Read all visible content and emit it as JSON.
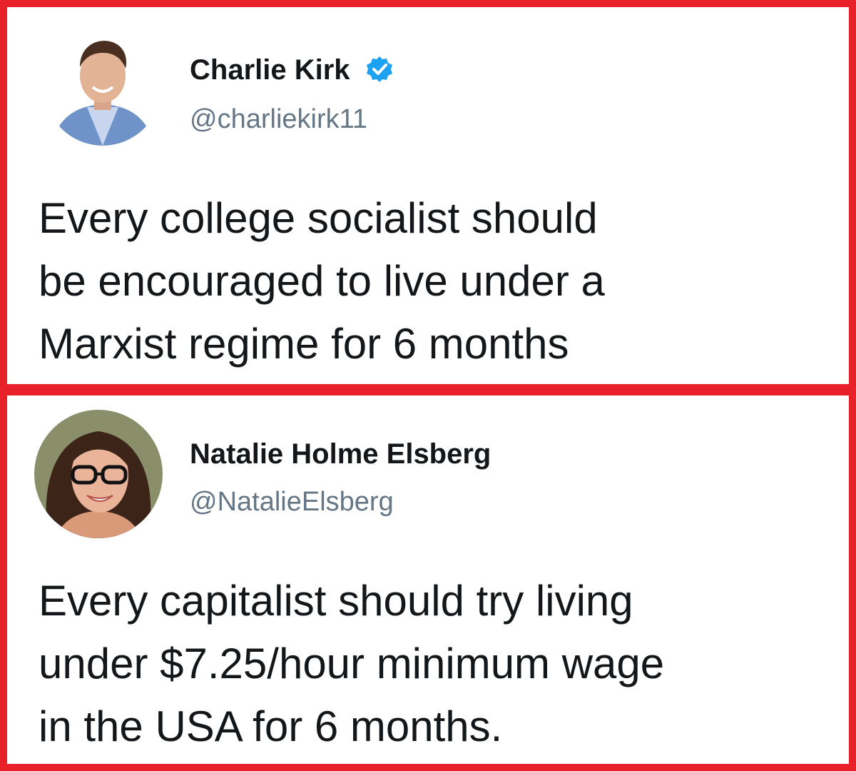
{
  "tweets": [
    {
      "author_name": "Charlie Kirk",
      "author_handle": "@charliekirk11",
      "verified": true,
      "text_lines": [
        "Every college socialist should",
        "be encouraged to live under a",
        "Marxist regime for 6 months"
      ]
    },
    {
      "author_name": "Natalie Holme Elsberg",
      "author_handle": "@NatalieElsberg",
      "verified": false,
      "text_lines": [
        "Every capitalist should try living",
        "under $7.25/hour minimum wage",
        "in the USA for 6 months."
      ]
    }
  ],
  "colors": {
    "frame": "#e8202a",
    "verified_badge": "#1da1f2",
    "handle": "#657786",
    "text": "#14171a"
  }
}
